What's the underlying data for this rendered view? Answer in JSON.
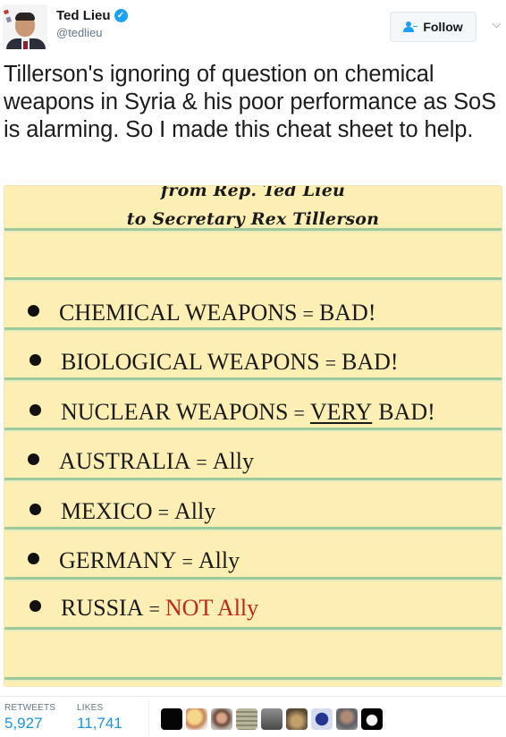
{
  "author": {
    "display_name": "Ted Lieu",
    "handle": "@tedlieu",
    "verified": true,
    "avatar_icon": "profile-photo"
  },
  "header": {
    "follow_label": "Follow",
    "follow_icon": "add-user-icon",
    "more_icon": "chevron-down-icon"
  },
  "tweet": {
    "text": "Tillerson's ignoring of question on chemical weapons in Syria & his poor performance as SoS is alarming. So I made this cheat sheet to help."
  },
  "cheat_sheet": {
    "title_line1": "from Rep. Ted Lieu",
    "title_line2": "to Secretary Rex Tillerson",
    "items": [
      {
        "subject": "CHEMICAL WEAPONS",
        "eq": "=",
        "value": "BAD!"
      },
      {
        "subject": "BIOLOGICAL WEAPONS",
        "eq": "=",
        "value": "BAD!"
      },
      {
        "subject": "NUCLEAR WEAPONS",
        "eq": "=",
        "emphasis": "VERY",
        "value": "BAD!"
      },
      {
        "subject": "AUSTRALIA",
        "eq": "=",
        "value": "Ally"
      },
      {
        "subject": "MEXICO",
        "eq": "=",
        "value": "Ally"
      },
      {
        "subject": "GERMANY",
        "eq": "=",
        "value": "Ally"
      },
      {
        "subject": "RUSSIA",
        "eq": "=",
        "value": "NOT Ally",
        "value_color": "#c0281a"
      }
    ],
    "paper_color": "#fdefb3",
    "rule_color": "#9dc99b"
  },
  "stats": {
    "retweets_label": "RETWEETS",
    "retweets_value": "5,927",
    "likes_label": "LIKES",
    "likes_value": "11,741"
  },
  "likers": [
    {
      "name": "liker-avatar-1"
    },
    {
      "name": "liker-avatar-2"
    },
    {
      "name": "liker-avatar-3"
    },
    {
      "name": "liker-avatar-4"
    },
    {
      "name": "liker-avatar-5"
    },
    {
      "name": "liker-avatar-6"
    },
    {
      "name": "liker-avatar-7"
    },
    {
      "name": "liker-avatar-8"
    },
    {
      "name": "liker-avatar-9"
    }
  ]
}
